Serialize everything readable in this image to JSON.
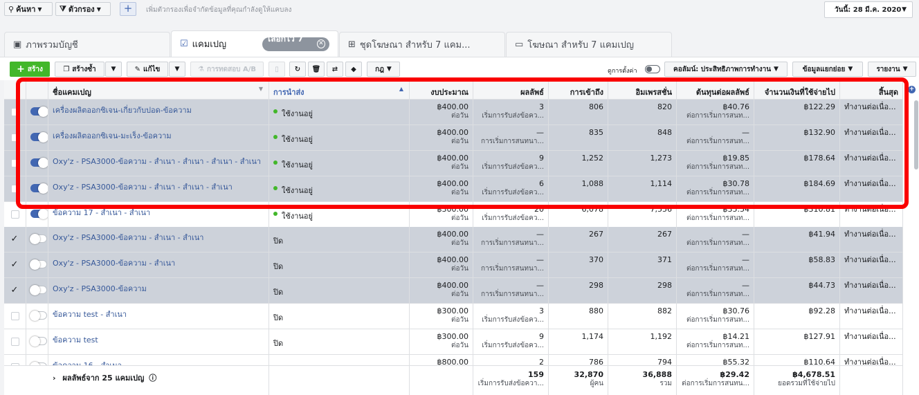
{
  "filters": {
    "search_label": "ค้นหา",
    "filter_label": "ตัวกรอง",
    "hint": "เพิ่มตัวกรองเพื่อจำกัดข้อมูลที่คุณกำลังดูให้แคบลง",
    "date_range": "วันนี้: 28 มี.ค. 2020"
  },
  "tabs": [
    {
      "label": "ภาพรวมบัญชี"
    },
    {
      "label": "แคมเปญ",
      "selected_pill": "เลือกไว้ 7 ..."
    },
    {
      "label": "ชุดโฆษณา สำหรับ 7 แคม..."
    },
    {
      "label": "โฆษณา สำหรับ 7 แคมเปญ"
    }
  ],
  "toolbar": {
    "create": "สร้าง",
    "duplicate": "สร้างซ้ำ",
    "edit": "แก้ไข",
    "ab_test": "การทดสอบ A/B",
    "rules": "กฎ",
    "view_setup": "ดูการตั้งค่า",
    "columns": "คอลัมน์: ประสิทธิภาพการทำงาน",
    "breakdown": "ข้อมูลแยกย่อย",
    "reports": "รายงาน"
  },
  "columns": [
    "ชื่อแคมเปญ",
    "การนำส่ง",
    "งบประมาณ",
    "ผลลัพธ์",
    "การเข้าถึง",
    "อิมเพรสชั่น",
    "ต้นทุนต่อผลลัพธ์",
    "จำนวนเงินที่ใช้จ่ายไป",
    "สิ้นสุด"
  ],
  "rows": [
    {
      "checked": false,
      "on": true,
      "name": "เครื่องผลิตออกซิเจน-เกี่ยวกับปอด-ข้อความ",
      "delivery": "ใช้งานอยู่",
      "active": true,
      "budget": "฿400.00",
      "budget_sub": "ต่อวัน",
      "result": "3",
      "result_sub": "เริ่มการรับส่งข้อคว...",
      "reach": "806",
      "impressions": "820",
      "cost": "฿40.76",
      "cost_sub": "ต่อการเริ่มการสนท...",
      "spent": "฿122.29",
      "end": "ทำงานต่อเนื่อ...",
      "selected": true
    },
    {
      "checked": false,
      "on": true,
      "name": "เครื่องผลิตออกซิเจน-มะเร็ง-ข้อความ",
      "delivery": "ใช้งานอยู่",
      "active": true,
      "budget": "฿400.00",
      "budget_sub": "ต่อวัน",
      "result": "—",
      "result_sub": "การเริ่มการสนทนา...",
      "reach": "835",
      "impressions": "848",
      "cost": "—",
      "cost_sub": "ต่อการเริ่มการสนท...",
      "spent": "฿132.90",
      "end": "ทำงานต่อเนื่อ...",
      "selected": true
    },
    {
      "checked": false,
      "on": true,
      "name": "Oxy'z - PSA3000-ข้อความ - สำเนา - สำเนา - สำเนา - สำเนา",
      "delivery": "ใช้งานอยู่",
      "active": true,
      "budget": "฿400.00",
      "budget_sub": "ต่อวัน",
      "result": "9",
      "result_sub": "เริ่มการรับส่งข้อคว...",
      "reach": "1,252",
      "impressions": "1,273",
      "cost": "฿19.85",
      "cost_sub": "ต่อการเริ่มการสนท...",
      "spent": "฿178.64",
      "end": "ทำงานต่อเนื่อ...",
      "selected": true
    },
    {
      "checked": false,
      "on": true,
      "name": "Oxy'z - PSA3000-ข้อความ - สำเนา - สำเนา - สำเนา",
      "delivery": "ใช้งานอยู่",
      "active": true,
      "budget": "฿400.00",
      "budget_sub": "ต่อวัน",
      "result": "6",
      "result_sub": "เริ่มการรับส่งข้อคว...",
      "reach": "1,088",
      "impressions": "1,114",
      "cost": "฿30.78",
      "cost_sub": "ต่อการเริ่มการสนท...",
      "spent": "฿184.69",
      "end": "ทำงานต่อเนื่อ...",
      "selected": true
    },
    {
      "checked": false,
      "on": true,
      "name": "ข้อความ 17 - สำเนา - สำเนา",
      "delivery": "ใช้งานอยู่",
      "active": true,
      "budget": "฿300.00",
      "budget_sub": "ต่อวัน",
      "result": "20",
      "result_sub": "เริ่มการรับส่งข้อคว...",
      "reach": "6,078",
      "impressions": "7,556",
      "cost": "฿35.54",
      "cost_sub": "ต่อการเริ่มการสนท...",
      "spent": "฿310.81",
      "end": "ทำงานต่อเนื่อ...",
      "selected": false
    },
    {
      "checked": true,
      "on": false,
      "name": "Oxy'z - PSA3000-ข้อความ - สำเนา - สำเนา",
      "delivery": "ปิด",
      "active": false,
      "budget": "฿400.00",
      "budget_sub": "ต่อวัน",
      "result": "—",
      "result_sub": "การเริ่มการสนทนา...",
      "reach": "267",
      "impressions": "267",
      "cost": "—",
      "cost_sub": "ต่อการเริ่มการสนท...",
      "spent": "฿41.94",
      "end": "ทำงานต่อเนื่อ...",
      "selected": true
    },
    {
      "checked": true,
      "on": false,
      "name": "Oxy'z - PSA3000-ข้อความ - สำเนา",
      "delivery": "ปิด",
      "active": false,
      "budget": "฿400.00",
      "budget_sub": "ต่อวัน",
      "result": "—",
      "result_sub": "การเริ่มการสนทนา...",
      "reach": "370",
      "impressions": "371",
      "cost": "—",
      "cost_sub": "ต่อการเริ่มการสนท...",
      "spent": "฿58.83",
      "end": "ทำงานต่อเนื่อ...",
      "selected": true
    },
    {
      "checked": true,
      "on": false,
      "name": "Oxy'z - PSA3000-ข้อความ",
      "delivery": "ปิด",
      "active": false,
      "budget": "฿400.00",
      "budget_sub": "ต่อวัน",
      "result": "—",
      "result_sub": "การเริ่มการสนทนา...",
      "reach": "298",
      "impressions": "298",
      "cost": "—",
      "cost_sub": "ต่อการเริ่มการสนท...",
      "spent": "฿44.73",
      "end": "ทำงานต่อเนื่อ...",
      "selected": true
    },
    {
      "checked": false,
      "on": false,
      "name": "ข้อความ test - สำเนา",
      "delivery": "ปิด",
      "active": false,
      "budget": "฿300.00",
      "budget_sub": "ต่อวัน",
      "result": "3",
      "result_sub": "เริ่มการรับส่งข้อคว...",
      "reach": "880",
      "impressions": "882",
      "cost": "฿30.76",
      "cost_sub": "ต่อการเริ่มการสนท...",
      "spent": "฿92.28",
      "end": "ทำงานต่อเนื่อ...",
      "selected": false
    },
    {
      "checked": false,
      "on": false,
      "name": "ข้อความ test",
      "delivery": "ปิด",
      "active": false,
      "budget": "฿300.00",
      "budget_sub": "ต่อวัน",
      "result": "9",
      "result_sub": "เริ่มการรับส่งข้อคว...",
      "reach": "1,174",
      "impressions": "1,192",
      "cost": "฿14.21",
      "cost_sub": "ต่อการเริ่มการสนท...",
      "spent": "฿127.91",
      "end": "ทำงานต่อเนื่อ...",
      "selected": false
    },
    {
      "checked": false,
      "on": false,
      "name": "ข้อความ 16 - สำเนา",
      "delivery": "ปิด",
      "active": false,
      "budget": "฿800.00",
      "budget_sub": "",
      "result": "2",
      "result_sub": "",
      "reach": "786",
      "impressions": "794",
      "cost": "฿55.32",
      "cost_sub": "",
      "spent": "฿110.64",
      "end": "ทำงานต่อเนื่อ...",
      "selected": false
    }
  ],
  "footer": {
    "label": "ผลลัพธ์จาก 25 แคมเปญ",
    "result": "159",
    "result_sub": "เริ่มการรับส่งข้อควา...",
    "reach": "32,870",
    "reach_sub": "ผู้คน",
    "impressions": "36,888",
    "impressions_sub": "รวม",
    "cost": "฿29.42",
    "cost_sub": "ต่อการเริ่มการสนทน...",
    "spent": "฿4,678.51",
    "spent_sub": "ยอดรวมที่ใช้จ่ายไป"
  }
}
